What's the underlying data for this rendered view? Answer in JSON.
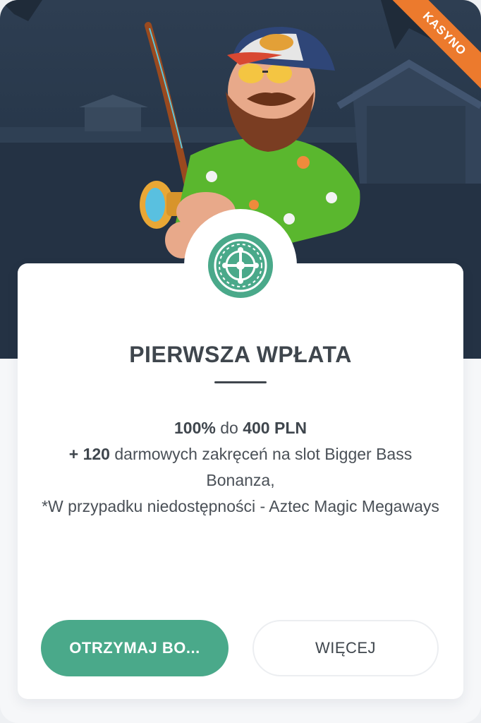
{
  "badge": {
    "label": "KASYNO",
    "color": "#ec7a2d"
  },
  "hero": {
    "character": "fisherman-mascot"
  },
  "card": {
    "icon": "roulette-wheel-icon",
    "title": "PIERWSZA WPŁATA",
    "offer": {
      "line1_percent": "100%",
      "line1_mid": " do ",
      "line1_amount": "400 PLN",
      "line2_bold": "+ 120",
      "line2_rest": " darmowych zakręceń na slot Bigger Bass Bonanza,",
      "line3": "*W przypadku niedostępności - Aztec Magic Megaways"
    }
  },
  "buttons": {
    "primary_label": "OTRZYMAJ BO...",
    "secondary_label": "WIĘCEJ"
  },
  "colors": {
    "accent": "#4aa98a",
    "title": "#3f464d",
    "hero_bg": "#2b3a4e"
  }
}
